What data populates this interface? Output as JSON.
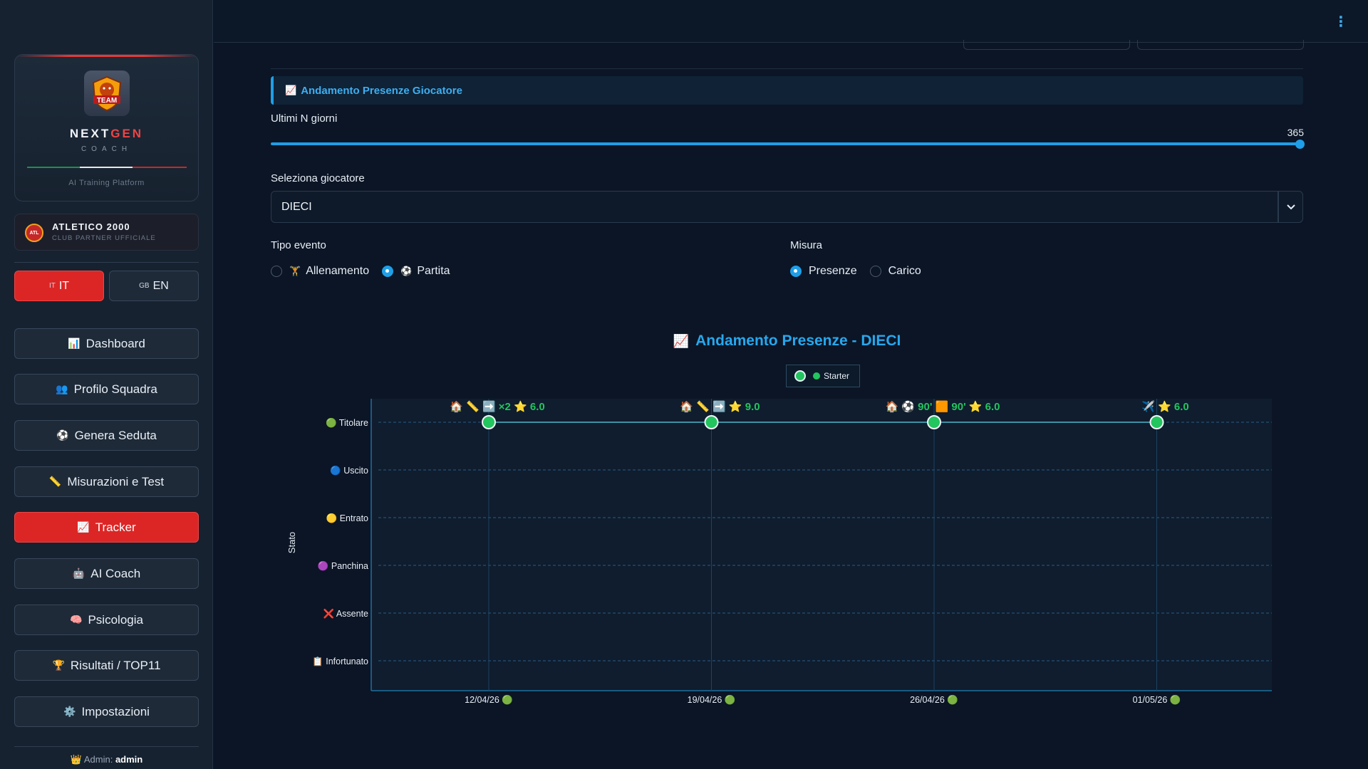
{
  "brand": {
    "logo_text": "TEAM",
    "name_a": "NEXT",
    "name_b": "GEN",
    "sub": "COACH",
    "tagline": "AI Training Platform"
  },
  "club": {
    "badge": "ATL",
    "name": "ATLETICO 2000",
    "sub": "CLUB PARTNER UFFICIALE"
  },
  "lang": {
    "it_flag": "IT",
    "it_label": "IT",
    "en_flag": "GB",
    "en_label": "EN",
    "active": "IT"
  },
  "nav": [
    {
      "icon": "📊",
      "icon_name": "bar-chart-icon",
      "label": "Dashboard"
    },
    {
      "icon": "👥",
      "icon_name": "team-icon",
      "label": "Profilo Squadra"
    },
    {
      "icon": "⚽",
      "icon_name": "soccer-ball-icon",
      "label": "Genera Seduta"
    },
    {
      "icon": "📏",
      "icon_name": "ruler-icon",
      "label": "Misurazioni e Test"
    },
    {
      "icon": "📈",
      "icon_name": "trend-icon",
      "label": "Tracker"
    },
    {
      "icon": "🤖",
      "icon_name": "robot-icon",
      "label": "AI Coach"
    },
    {
      "icon": "🧠",
      "icon_name": "brain-icon",
      "label": "Psicologia"
    },
    {
      "icon": "🏆",
      "icon_name": "trophy-icon",
      "label": "Risultati / TOP11"
    },
    {
      "icon": "⚙️",
      "icon_name": "gear-icon",
      "label": "Impostazioni"
    }
  ],
  "nav_active": "Tracker",
  "admin": {
    "icon": "👑",
    "prefix": "Admin:",
    "user": "admin"
  },
  "topbar": {
    "menu_icon": "⋮"
  },
  "section": {
    "icon": "📈",
    "title": "Andamento Presenze Giocatore"
  },
  "days": {
    "label": "Ultimi N giorni",
    "value": "365",
    "fraction": 1.0
  },
  "player": {
    "label": "Seleziona giocatore",
    "value": "DIECI",
    "chevron": "⌄"
  },
  "event_type": {
    "label": "Tipo evento",
    "options": [
      {
        "icon": "🏋",
        "label": "Allenamento",
        "selected": false
      },
      {
        "icon": "⚽",
        "label": "Partita",
        "selected": true
      }
    ]
  },
  "measure": {
    "label": "Misura",
    "options": [
      {
        "label": "Presenze",
        "selected": true
      },
      {
        "label": "Carico",
        "selected": false
      }
    ]
  },
  "chart_data": {
    "type": "line",
    "title_icon": "📈",
    "title": "Andamento Presenze - DIECI",
    "ylabel": "Stato",
    "legend": [
      {
        "icon": "🟢",
        "label": "Starter"
      }
    ],
    "legend_placement": "top-center",
    "grid": true,
    "categories": [
      "Titolare",
      "Uscito",
      "Entrato",
      "Panchina",
      "Assente",
      "Infortunato"
    ],
    "category_icons": [
      "🟢",
      "🔵",
      "🟡",
      "🟣",
      "❌",
      "📋"
    ],
    "x": [
      "12/04/26",
      "19/04/26",
      "26/04/26",
      "01/05/26"
    ],
    "x_tick_icon": "🟢",
    "series": [
      {
        "name": "Starter",
        "color": "#22c55e",
        "values": [
          "Titolare",
          "Titolare",
          "Titolare",
          "Titolare"
        ],
        "annotations": [
          {
            "icons": "🏠 📏 ➡️",
            "text_a": "×2",
            "star": "⭐",
            "text_b": "6.0"
          },
          {
            "icons": "🏠 📏 ➡️",
            "text_a": "",
            "star": "⭐",
            "text_b": "9.0"
          },
          {
            "icons": "🏠 ⚽",
            "text_a": "90' 🟧 90'",
            "star": "⭐",
            "text_b": "6.0"
          },
          {
            "icons": "✈️",
            "text_a": "",
            "star": "⭐",
            "text_b": "6.0"
          }
        ]
      }
    ]
  },
  "colors": {
    "accent": "#1f9fe8",
    "active_red": "#dc2626",
    "marker_green": "#22c55e",
    "bg": "#0b1525",
    "sidebar": "#162230"
  }
}
